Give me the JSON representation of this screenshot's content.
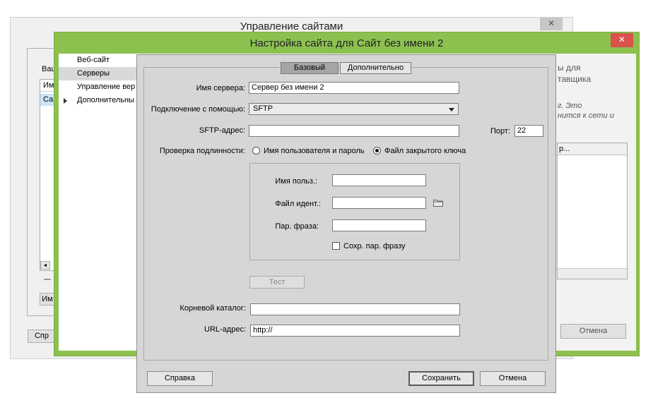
{
  "back_window": {
    "title": "Управление сайтами",
    "close": "✕",
    "label_partial": "Ваш",
    "list_rows": [
      "Им",
      "Са"
    ],
    "btn_partial_1": "Им",
    "btn_partial_2": "Спр",
    "scroll_left": "◄"
  },
  "mid_window": {
    "title": "Настройка сайта для Сайт без имени 2",
    "close": "✕",
    "sidebar": [
      {
        "label": "Веб-сайт"
      },
      {
        "label": "Серверы"
      },
      {
        "label": "Управление вер"
      },
      {
        "label": "Дополнительны"
      }
    ],
    "right_text_1": "ы для",
    "right_text_2": "тавщика",
    "right_text_3": "г. Это",
    "right_text_4": "нится к сети и",
    "table_header_partial": "р...",
    "cancel": "Отмена"
  },
  "dialog": {
    "tabs": {
      "basic": "Базовый",
      "advanced": "Дополнительно"
    },
    "server_name_label": "Имя сервера:",
    "server_name_value": "Сервер без имени 2",
    "connect_label": "Подключение с помощью:",
    "connect_value": "SFTP",
    "sftp_label": "SFTP-адрес:",
    "sftp_value": "",
    "port_label": "Порт:",
    "port_value": "22",
    "auth_label": "Проверка подлинности:",
    "auth_option_1": "Имя пользователя и пароль",
    "auth_option_2": "Файл закрытого ключа",
    "username_label": "Имя польз.:",
    "identity_label": "Файл идент.:",
    "passphrase_label": "Пар. фраза:",
    "save_phrase_label": "Сохр. пар. фразу",
    "test_button": "Тест",
    "root_label": "Корневой каталог:",
    "root_value": "",
    "url_label": "URL-адрес:",
    "url_value": "http://",
    "help_button": "Справка",
    "save_button": "Сохранить",
    "cancel_button": "Отмена"
  }
}
